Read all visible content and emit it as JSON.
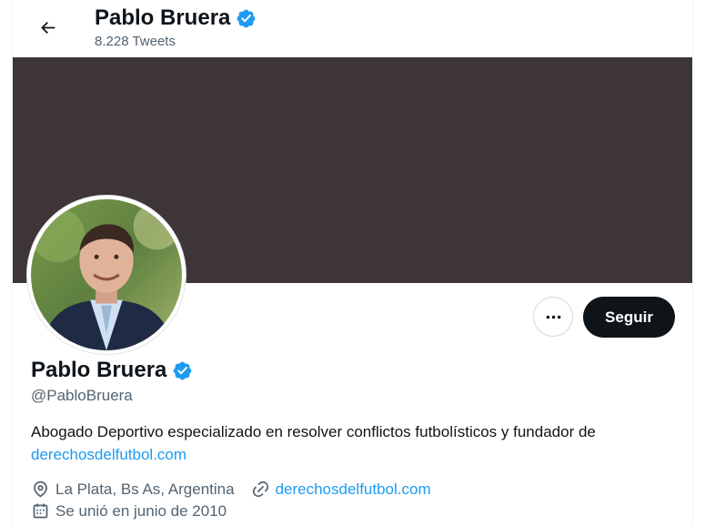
{
  "header": {
    "name": "Pablo Bruera",
    "tweets_count": "8.228 Tweets"
  },
  "actions": {
    "follow_label": "Seguir"
  },
  "profile": {
    "name": "Pablo Bruera",
    "handle": "@PabloBruera",
    "bio_text": "Abogado Deportivo especializado en resolver conflictos futbolísticos y fundador de",
    "bio_link": "derechosdelfutbol.com",
    "location": "La Plata, Bs As, Argentina",
    "website": "derechosdelfutbol.com",
    "joined": "Se unió en junio de 2010"
  },
  "colors": {
    "banner": "#3e3538",
    "accent": "#1d9bf0",
    "follow_button": "#0f1419"
  }
}
